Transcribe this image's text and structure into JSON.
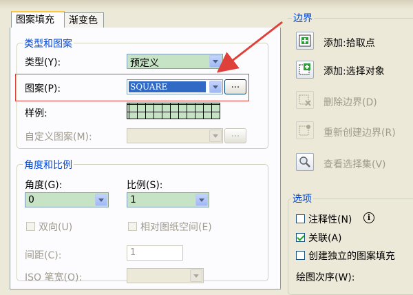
{
  "tabs": {
    "hatch": "图案填充",
    "gradient": "渐变色"
  },
  "type_pattern_group": {
    "title": "类型和图案",
    "type_label": "类型(Y):",
    "type_value": "预定义",
    "pattern_label": "图案(P):",
    "pattern_value": "SQUARE",
    "swatch_label": "样例:",
    "custom_label": "自定义图案(M):",
    "browse_label": "..."
  },
  "angle_scale_group": {
    "title": "角度和比例",
    "angle_label": "角度(G):",
    "angle_value": "0",
    "scale_label": "比例(S):",
    "scale_value": "1",
    "double_label": "双向(U)",
    "relative_label": "相对图纸空间(E)",
    "spacing_label": "间距(C):",
    "spacing_value": "1",
    "iso_label": "ISO 笔宽(O):"
  },
  "boundary_group": {
    "title": "边界",
    "add_pick": "添加:拾取点",
    "add_select": "添加:选择对象",
    "remove": "删除边界(D)",
    "recreate": "重新创建边界(R)",
    "view": "查看选择集(V)"
  },
  "options_group": {
    "title": "选项",
    "annotative": "注释性(N)",
    "info_glyph": "i",
    "associative": "关联(A)",
    "independent": "创建独立的图案填充",
    "draw_order": "绘图次序(W):"
  },
  "colors": {
    "accent_blue": "#0046d5",
    "highlight_red": "#e0403a",
    "combo_green": "#c6e3c6",
    "selected_blue": "#316ac5"
  }
}
